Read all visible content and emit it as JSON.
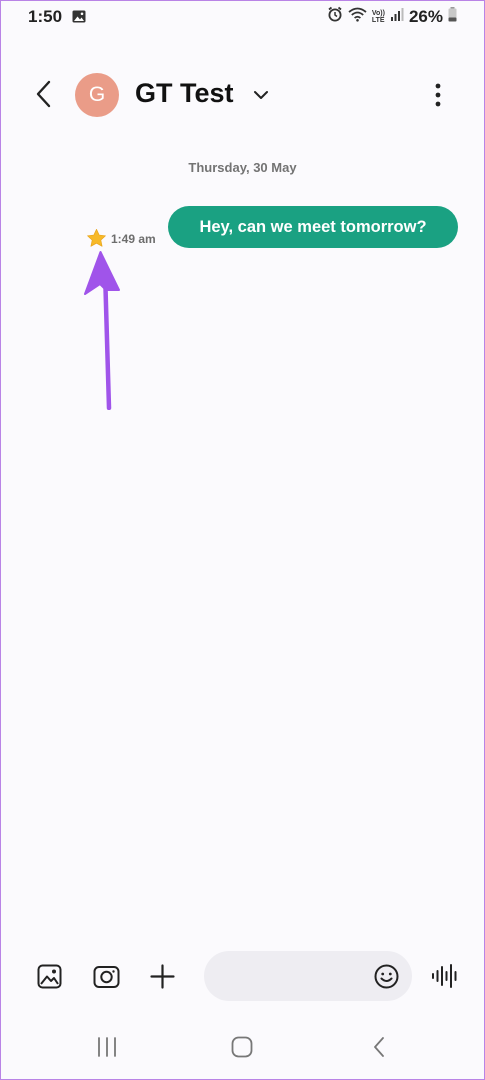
{
  "status_bar": {
    "time": "1:50",
    "battery": "26%",
    "volte_top": "Vo))",
    "volte_bottom": "LTE"
  },
  "header": {
    "avatar_letter": "G",
    "contact_name": "GT Test"
  },
  "conversation": {
    "date_separator": "Thursday, 30 May",
    "messages": [
      {
        "text": "Hey, can we meet tomorrow?",
        "time": "1:49 am",
        "starred": true,
        "outgoing": true
      }
    ]
  },
  "input_bar": {
    "placeholder": ""
  },
  "colors": {
    "bubble": "#1aa182",
    "avatar": "#ea9c88",
    "star": "#f7b928",
    "arrow": "#a054ea",
    "frame": "#b983e6"
  },
  "icons": {
    "status_left": [
      "gallery-icon"
    ],
    "status_right": [
      "alarm-icon",
      "wifi-icon",
      "volte-icon",
      "signal-icon",
      "battery-icon"
    ],
    "header": [
      "back-icon",
      "chevron-down-icon",
      "more-vertical-icon"
    ],
    "input_bar": [
      "gallery-icon",
      "camera-icon",
      "plus-icon",
      "emoji-icon",
      "voice-wave-icon"
    ],
    "nav_bar": [
      "recents-icon",
      "home-icon",
      "back-icon"
    ]
  }
}
